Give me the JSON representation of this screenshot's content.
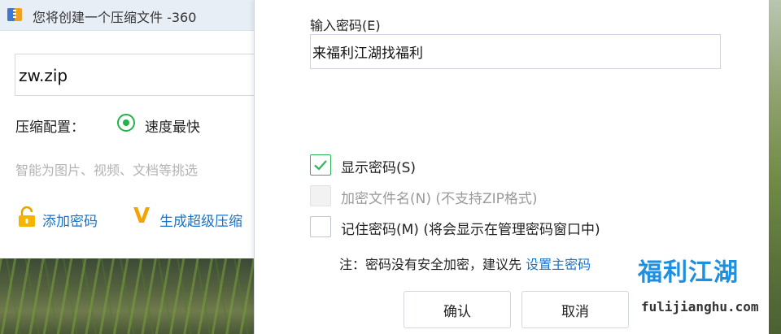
{
  "background_window": {
    "title": "您将创建一个压缩文件 -360",
    "filename": "zw.zip",
    "config_label": "压缩配置：",
    "speed_option": "速度最快",
    "hint": "智能为图片、视频、文档等挑选",
    "add_password": "添加密码",
    "generate_link": "生成超级压缩"
  },
  "dialog": {
    "password_label": "输入密码(E)",
    "password_value": "来福利江湖找福利",
    "show_password": {
      "label": "显示密码(S)",
      "checked": true
    },
    "encrypt_filename": {
      "label": "加密文件名(N) (不支持ZIP格式)",
      "disabled": true
    },
    "remember_password": {
      "label": "记住密码(M) (将会显示在管理密码窗口中)",
      "checked": false
    },
    "note_text": "注：密码没有安全加密，建议先 ",
    "note_link": "设置主密码",
    "ok_button": "确认",
    "cancel_button": "取消"
  },
  "watermark": {
    "part1": "福利",
    "part2": "江湖",
    "url": "fulijianghu.com"
  },
  "colors": {
    "accent_green": "#2fb35a",
    "link_blue": "#1a73c8",
    "watermark_blue": "#1f8fe0"
  }
}
